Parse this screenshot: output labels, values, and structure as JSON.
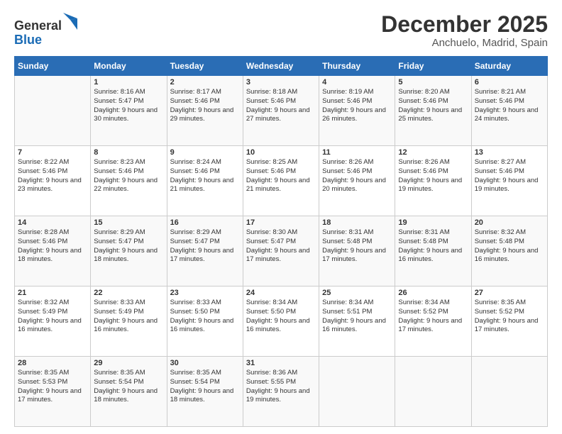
{
  "header": {
    "logo_line1": "General",
    "logo_line2": "Blue",
    "month": "December 2025",
    "location": "Anchuelo, Madrid, Spain"
  },
  "weekdays": [
    "Sunday",
    "Monday",
    "Tuesday",
    "Wednesday",
    "Thursday",
    "Friday",
    "Saturday"
  ],
  "weeks": [
    [
      {
        "day": "",
        "sunrise": "",
        "sunset": "",
        "daylight": ""
      },
      {
        "day": "1",
        "sunrise": "Sunrise: 8:16 AM",
        "sunset": "Sunset: 5:47 PM",
        "daylight": "Daylight: 9 hours and 30 minutes."
      },
      {
        "day": "2",
        "sunrise": "Sunrise: 8:17 AM",
        "sunset": "Sunset: 5:46 PM",
        "daylight": "Daylight: 9 hours and 29 minutes."
      },
      {
        "day": "3",
        "sunrise": "Sunrise: 8:18 AM",
        "sunset": "Sunset: 5:46 PM",
        "daylight": "Daylight: 9 hours and 27 minutes."
      },
      {
        "day": "4",
        "sunrise": "Sunrise: 8:19 AM",
        "sunset": "Sunset: 5:46 PM",
        "daylight": "Daylight: 9 hours and 26 minutes."
      },
      {
        "day": "5",
        "sunrise": "Sunrise: 8:20 AM",
        "sunset": "Sunset: 5:46 PM",
        "daylight": "Daylight: 9 hours and 25 minutes."
      },
      {
        "day": "6",
        "sunrise": "Sunrise: 8:21 AM",
        "sunset": "Sunset: 5:46 PM",
        "daylight": "Daylight: 9 hours and 24 minutes."
      }
    ],
    [
      {
        "day": "7",
        "sunrise": "Sunrise: 8:22 AM",
        "sunset": "Sunset: 5:46 PM",
        "daylight": "Daylight: 9 hours and 23 minutes."
      },
      {
        "day": "8",
        "sunrise": "Sunrise: 8:23 AM",
        "sunset": "Sunset: 5:46 PM",
        "daylight": "Daylight: 9 hours and 22 minutes."
      },
      {
        "day": "9",
        "sunrise": "Sunrise: 8:24 AM",
        "sunset": "Sunset: 5:46 PM",
        "daylight": "Daylight: 9 hours and 21 minutes."
      },
      {
        "day": "10",
        "sunrise": "Sunrise: 8:25 AM",
        "sunset": "Sunset: 5:46 PM",
        "daylight": "Daylight: 9 hours and 21 minutes."
      },
      {
        "day": "11",
        "sunrise": "Sunrise: 8:26 AM",
        "sunset": "Sunset: 5:46 PM",
        "daylight": "Daylight: 9 hours and 20 minutes."
      },
      {
        "day": "12",
        "sunrise": "Sunrise: 8:26 AM",
        "sunset": "Sunset: 5:46 PM",
        "daylight": "Daylight: 9 hours and 19 minutes."
      },
      {
        "day": "13",
        "sunrise": "Sunrise: 8:27 AM",
        "sunset": "Sunset: 5:46 PM",
        "daylight": "Daylight: 9 hours and 19 minutes."
      }
    ],
    [
      {
        "day": "14",
        "sunrise": "Sunrise: 8:28 AM",
        "sunset": "Sunset: 5:46 PM",
        "daylight": "Daylight: 9 hours and 18 minutes."
      },
      {
        "day": "15",
        "sunrise": "Sunrise: 8:29 AM",
        "sunset": "Sunset: 5:47 PM",
        "daylight": "Daylight: 9 hours and 18 minutes."
      },
      {
        "day": "16",
        "sunrise": "Sunrise: 8:29 AM",
        "sunset": "Sunset: 5:47 PM",
        "daylight": "Daylight: 9 hours and 17 minutes."
      },
      {
        "day": "17",
        "sunrise": "Sunrise: 8:30 AM",
        "sunset": "Sunset: 5:47 PM",
        "daylight": "Daylight: 9 hours and 17 minutes."
      },
      {
        "day": "18",
        "sunrise": "Sunrise: 8:31 AM",
        "sunset": "Sunset: 5:48 PM",
        "daylight": "Daylight: 9 hours and 17 minutes."
      },
      {
        "day": "19",
        "sunrise": "Sunrise: 8:31 AM",
        "sunset": "Sunset: 5:48 PM",
        "daylight": "Daylight: 9 hours and 16 minutes."
      },
      {
        "day": "20",
        "sunrise": "Sunrise: 8:32 AM",
        "sunset": "Sunset: 5:48 PM",
        "daylight": "Daylight: 9 hours and 16 minutes."
      }
    ],
    [
      {
        "day": "21",
        "sunrise": "Sunrise: 8:32 AM",
        "sunset": "Sunset: 5:49 PM",
        "daylight": "Daylight: 9 hours and 16 minutes."
      },
      {
        "day": "22",
        "sunrise": "Sunrise: 8:33 AM",
        "sunset": "Sunset: 5:49 PM",
        "daylight": "Daylight: 9 hours and 16 minutes."
      },
      {
        "day": "23",
        "sunrise": "Sunrise: 8:33 AM",
        "sunset": "Sunset: 5:50 PM",
        "daylight": "Daylight: 9 hours and 16 minutes."
      },
      {
        "day": "24",
        "sunrise": "Sunrise: 8:34 AM",
        "sunset": "Sunset: 5:50 PM",
        "daylight": "Daylight: 9 hours and 16 minutes."
      },
      {
        "day": "25",
        "sunrise": "Sunrise: 8:34 AM",
        "sunset": "Sunset: 5:51 PM",
        "daylight": "Daylight: 9 hours and 16 minutes."
      },
      {
        "day": "26",
        "sunrise": "Sunrise: 8:34 AM",
        "sunset": "Sunset: 5:52 PM",
        "daylight": "Daylight: 9 hours and 17 minutes."
      },
      {
        "day": "27",
        "sunrise": "Sunrise: 8:35 AM",
        "sunset": "Sunset: 5:52 PM",
        "daylight": "Daylight: 9 hours and 17 minutes."
      }
    ],
    [
      {
        "day": "28",
        "sunrise": "Sunrise: 8:35 AM",
        "sunset": "Sunset: 5:53 PM",
        "daylight": "Daylight: 9 hours and 17 minutes."
      },
      {
        "day": "29",
        "sunrise": "Sunrise: 8:35 AM",
        "sunset": "Sunset: 5:54 PM",
        "daylight": "Daylight: 9 hours and 18 minutes."
      },
      {
        "day": "30",
        "sunrise": "Sunrise: 8:35 AM",
        "sunset": "Sunset: 5:54 PM",
        "daylight": "Daylight: 9 hours and 18 minutes."
      },
      {
        "day": "31",
        "sunrise": "Sunrise: 8:36 AM",
        "sunset": "Sunset: 5:55 PM",
        "daylight": "Daylight: 9 hours and 19 minutes."
      },
      {
        "day": "",
        "sunrise": "",
        "sunset": "",
        "daylight": ""
      },
      {
        "day": "",
        "sunrise": "",
        "sunset": "",
        "daylight": ""
      },
      {
        "day": "",
        "sunrise": "",
        "sunset": "",
        "daylight": ""
      }
    ]
  ]
}
